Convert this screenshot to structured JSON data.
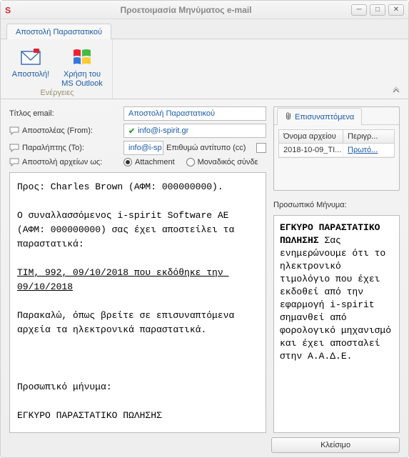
{
  "window": {
    "title": "Προετοιμασία Μηνύματος e-mail",
    "tab": "Αποστολή Παραστατικού"
  },
  "ribbon": {
    "group_label": "Ενέργειες",
    "send_label": "Αποστολή!",
    "outlook_label": "Χρήση του\nMS Outlook"
  },
  "form": {
    "title_label": "Τίτλος email:",
    "title_value": "Αποστολή Παραστατικού",
    "sender_label": "Αποστολέας (From):",
    "sender_value": "info@i-spirit.gr",
    "recipient_label": "Παραλήπτης (To):",
    "recipient_value": "info@i-sp",
    "cc_label": "Επιθυμώ αντίτυπο (cc)",
    "sendas_label": "Αποστολή αρχείων ως:",
    "radio_attachment": "Attachment",
    "radio_unique": "Μοναδικός σύνδε"
  },
  "body": {
    "to_line": "Προς: Charles Brown (ΑΦΜ: 000000000).",
    "intro": "Ο συναλλασσόμενος i-spirit Software AE (ΑΦΜ: 000000000) σας έχει αποστείλει τα παραστατικά:",
    "doc_line": "ΤΙΜ, 992, 09/10/2018 που εκδόθηκε την 09/10/2018",
    "please": "Παρακαλώ, όπως βρείτε σε επισυναπτόμενα αρχεία τα ηλεκτρονικά παραστατικά.",
    "pm_heading": "Προσωπικό μήνυμα:",
    "pm_line": "ΕΓΚΥΡΟ ΠΑΡΑΣΤΑΤΙΚΟ ΠΩΛΗΣΗΣ"
  },
  "attachments": {
    "tab_label": "Επισυναπτόμενα",
    "col_name": "Όνομα αρχείου",
    "col_desc": "Περιγρ...",
    "rows": [
      {
        "name": "2018-10-09_TI...",
        "desc": "Πρωτό..."
      }
    ]
  },
  "personal": {
    "label": "Προσωπικό Μήνυμα:",
    "title": "ΕΓΚΥΡΟ ΠΑΡΑΣΤΑΤΙΚΟ ΠΩΛΗΣΗΣ",
    "text": "Σας ενημερώνουμε ότι το ηλεκτρονικό τιμολόγιο που έχει εκδοθεί από την εφαρμογή i-spirit σημανθεί από φορολογικό μηχανισμό και έχει αποσταλεί στην Α.Α.Δ.Ε."
  },
  "footer": {
    "close": "Κλείσιμο"
  }
}
